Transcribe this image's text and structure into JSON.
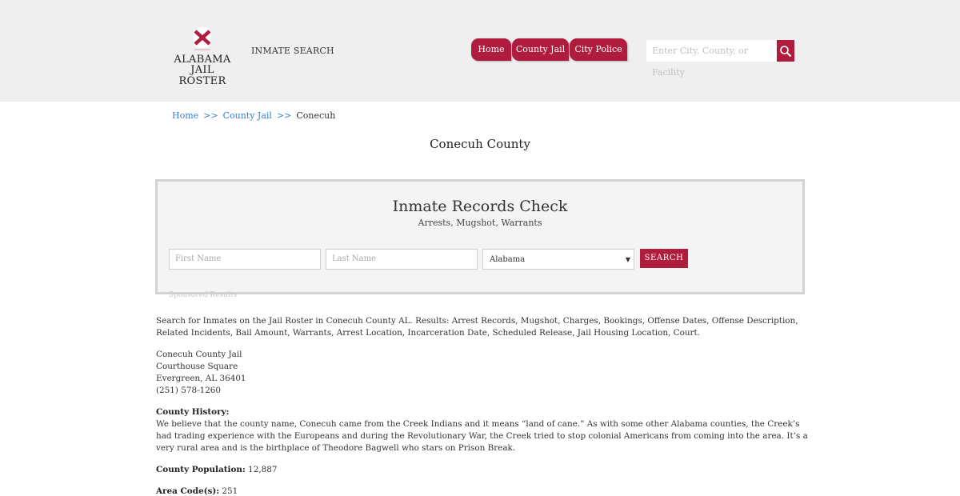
{
  "header": {
    "logo": {
      "line1": "ALABAMA",
      "line2": "JAIL ROSTER"
    },
    "inmate_search_label": "INMATE SEARCH",
    "nav": [
      {
        "label": "Home"
      },
      {
        "label": "County Jail"
      },
      {
        "label": "City Police"
      }
    ],
    "search": {
      "placeholder": "Enter City, County, or Facility"
    },
    "colors": {
      "accent": "#b01c3e",
      "background": "#efefef"
    }
  },
  "breadcrumb": {
    "home": "Home",
    "sep1": ">>",
    "county_jail": "County Jail",
    "sep2": ">>",
    "current": "Conecuh"
  },
  "page_title": "Conecuh County",
  "records_check": {
    "title": "Inmate Records Check",
    "subtitle": "Arrests, Mugshot, Warrants",
    "first_name_placeholder": "First Name",
    "last_name_placeholder": "Last Name",
    "state_selected": "Alabama",
    "search_button": "SEARCH",
    "sponsored": "Sponsored Results"
  },
  "content": {
    "intro": "Search for Inmates on the Jail Roster in Conecuh County AL. Results: Arrest Records, Mugshot, Charges, Bookings, Offense Dates, Offense Description, Related Incidents, Bail Amount, Warrants, Arrest Location, Incarceration Date, Scheduled Release, Jail Housing Location, Court.",
    "address": {
      "name": "Conecuh County Jail",
      "street": "Courthouse Square",
      "city": "Evergreen, AL 36401",
      "phone": "(251) 578-1260"
    },
    "history_label": "County History:",
    "history_text": "We believe that the county name, Conecuh came from the Creek Indians and it means “land of cane.” As with some other Alabama counties, the Creek’s had trading experience with the Europeans and during the Revolutionary War, the Creek tried to stop colonial Americans from coming into the area. It’s a very rural area and is the birthplace of Theodore Bagwell who stars on Prison Break.",
    "population_label": "County Population:",
    "population_value": "12,887",
    "area_code_label": "Area Code(s):",
    "area_code_value": "251"
  }
}
